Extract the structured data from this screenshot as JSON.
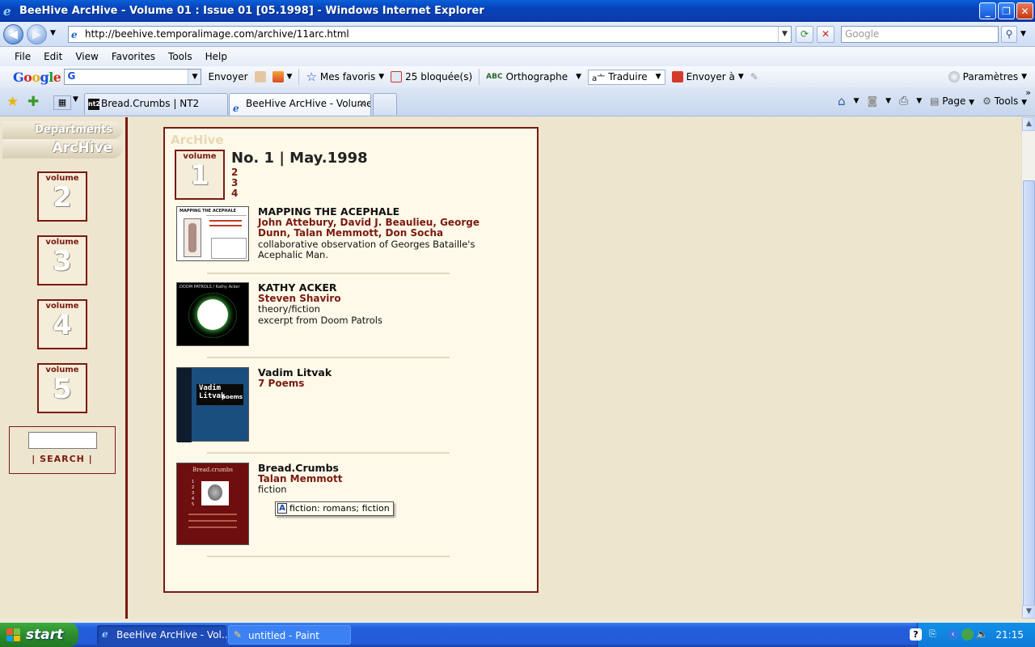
{
  "window": {
    "title": "BeeHive ArcHive - Volume 01 : Issue 01 [05.1998] - Windows Internet Explorer"
  },
  "address": {
    "url": "http://beehive.temporalimage.com/archive/11arc.html",
    "search_placeholder": "Google"
  },
  "menu": [
    "File",
    "Edit",
    "View",
    "Favorites",
    "Tools",
    "Help"
  ],
  "google_toolbar": {
    "envoyer": "Envoyer",
    "mes_favoris": "Mes favoris",
    "bloquees": "25 bloquée(s)",
    "orthographe": "Orthographe",
    "traduire": "Traduire",
    "envoyer_a": "Envoyer à",
    "parametres": "Paramètres"
  },
  "tabs": [
    {
      "label": "Bread.Crumbs | NT2",
      "icon": "nt2-icon"
    },
    {
      "label": "BeeHive ArcHive - Volume...",
      "icon": "ie-icon"
    }
  ],
  "tab_tools": {
    "page": "Page",
    "tools": "Tools"
  },
  "sidebar": {
    "departments": "Departments",
    "archive": "ArcHive",
    "volume_label": "volume",
    "volumes": [
      "2",
      "3",
      "4",
      "5"
    ],
    "search_label": "| SEARCH |"
  },
  "main": {
    "archive_title": "ArcHive",
    "volume_label": "volume",
    "volume_number": "1",
    "issue_header": "No. 1 | May.1998",
    "issue_links": [
      "2",
      "3",
      "4"
    ],
    "entries": [
      {
        "title": "MAPPING THE ACEPHALE",
        "authors": "John Attebury, David J. Beaulieu, George Dunn, Talan Memmott, Don Socha",
        "desc": [
          "collaborative observation of Georges Bataille's Acephalic Man."
        ]
      },
      {
        "title": "KATHY ACKER",
        "authors": "Steven Shaviro",
        "desc": [
          "theory/fiction",
          "excerpt from Doom Patrols"
        ]
      },
      {
        "title": "Vadim Litvak",
        "authors": "7 Poems",
        "desc": []
      },
      {
        "title": "Bread.Crumbs",
        "authors": "Talan Memmott",
        "desc": [
          "fiction"
        ]
      }
    ],
    "thumb_texts": {
      "mapping_header": "MAPPING THE ACEPHALE",
      "kathy_header": "DOOM PATROLS / Kathy Acker",
      "vadim_name": "Vadim Litvak",
      "vadim_sub": "poems",
      "bread_title": "Bread.crumbs",
      "bread_nums": [
        "1",
        "2",
        "3",
        "4",
        "5"
      ]
    },
    "tooltip": "fiction: romans; fiction"
  },
  "taskbar": {
    "start": "start",
    "tasks": [
      "BeeHive ArcHive - Vol...",
      "untitled - Paint"
    ],
    "clock": "21:15"
  },
  "colors": {
    "accent": "#7A1A10",
    "page_bg": "#EEE5CF",
    "panel_bg": "#FFF9E9"
  }
}
